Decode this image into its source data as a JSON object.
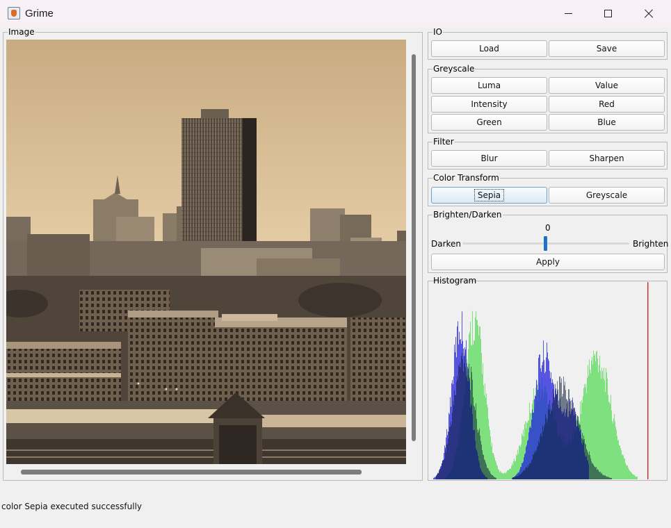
{
  "window": {
    "title": "Grime",
    "icon": "java-cup-icon",
    "controls": [
      "minimize",
      "maximize",
      "close"
    ]
  },
  "image_panel": {
    "label": "Image",
    "image_description": "sepia-toned city skyline photograph"
  },
  "io": {
    "label": "IO",
    "load": "Load",
    "save": "Save"
  },
  "greyscale": {
    "label": "Greyscale",
    "buttons": [
      "Luma",
      "Value",
      "Intensity",
      "Red",
      "Green",
      "Blue"
    ]
  },
  "filter": {
    "label": "Filter",
    "blur": "Blur",
    "sharpen": "Sharpen"
  },
  "color_transform": {
    "label": "Color Transform",
    "sepia": "Sepia",
    "greyscale": "Greyscale"
  },
  "brighten": {
    "label": "Brighten/Darken",
    "value": "0",
    "left_label": "Darken",
    "right_label": "Brighten",
    "apply": "Apply",
    "slider_fraction": 0.5
  },
  "histogram": {
    "label": "Histogram",
    "colors": {
      "red": "#cc3333",
      "green": "#22d422",
      "blue": "#2222dd",
      "background": "#f0f0f0"
    }
  },
  "status": "color Sepia executed successfully"
}
